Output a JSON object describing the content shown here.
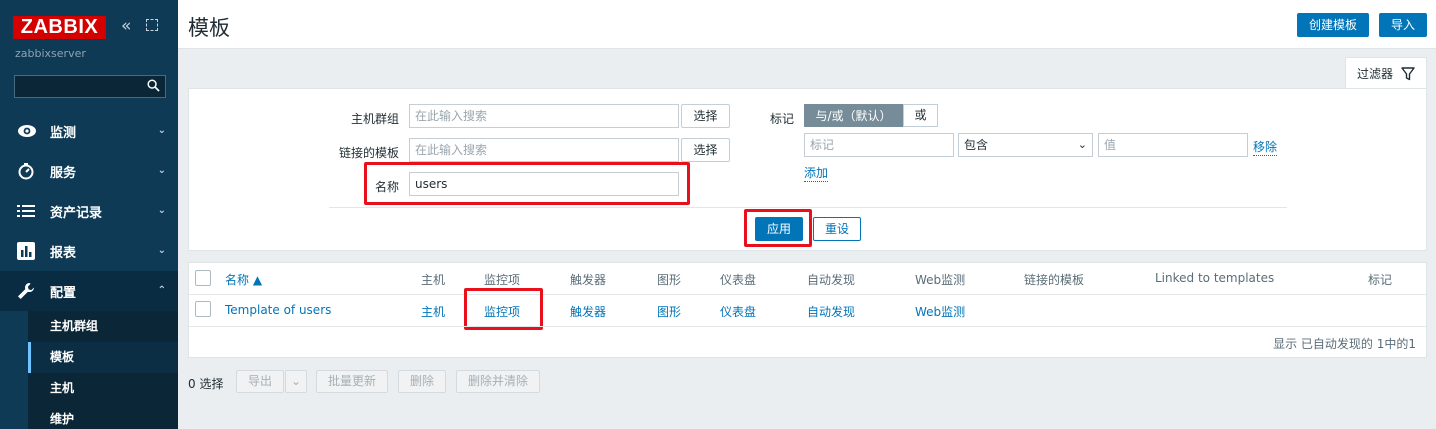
{
  "sidebar": {
    "logo": "ZABBIX",
    "server_name": "zabbixserver",
    "search_placeholder": "",
    "menu": [
      {
        "label": "监测"
      },
      {
        "label": "服务"
      },
      {
        "label": "资产记录"
      },
      {
        "label": "报表"
      },
      {
        "label": "配置"
      }
    ],
    "submenu": [
      {
        "label": "主机群组"
      },
      {
        "label": "模板"
      },
      {
        "label": "主机"
      },
      {
        "label": "维护"
      }
    ]
  },
  "header": {
    "title": "模板",
    "create_button": "创建模板",
    "import_button": "导入"
  },
  "filter": {
    "tab_label": "过滤器",
    "host_groups_label": "主机群组",
    "host_groups_placeholder": "在此输入搜索",
    "linked_templates_label": "链接的模板",
    "linked_templates_placeholder": "在此输入搜索",
    "select_button": "选择",
    "name_label": "名称",
    "name_value": "users",
    "tags_label": "标记",
    "tags_and_or": "与/或（默认）",
    "tags_or": "或",
    "tag_placeholder": "标记",
    "tag_operator": "包含",
    "tag_value_placeholder": "值",
    "remove_link": "移除",
    "add_link": "添加",
    "apply_button": "应用",
    "reset_button": "重设"
  },
  "table": {
    "headers": {
      "name": "名称 ▲",
      "hosts": "主机",
      "items": "监控项",
      "triggers": "触发器",
      "graphs": "图形",
      "dashboards": "仪表盘",
      "discovery": "自动发现",
      "web": "Web监测",
      "linked_templates": "链接的模板",
      "linked_to": "Linked to templates",
      "tags": "标记"
    },
    "rows": [
      {
        "name": "Template of users",
        "hosts": "主机",
        "items": "监控项",
        "triggers": "触发器",
        "graphs": "图形",
        "dashboards": "仪表盘",
        "discovery": "自动发现",
        "web": "Web监测"
      }
    ],
    "footer": "显示 已自动发现的 1中的1"
  },
  "actions": {
    "selected": "0 选择",
    "export": "导出",
    "mass_update": "批量更新",
    "delete": "删除",
    "delete_clear": "删除并清除"
  },
  "colors": {
    "sidebar": "#0e3a56",
    "accent": "#0275b8",
    "highlight": "#e8101a"
  }
}
